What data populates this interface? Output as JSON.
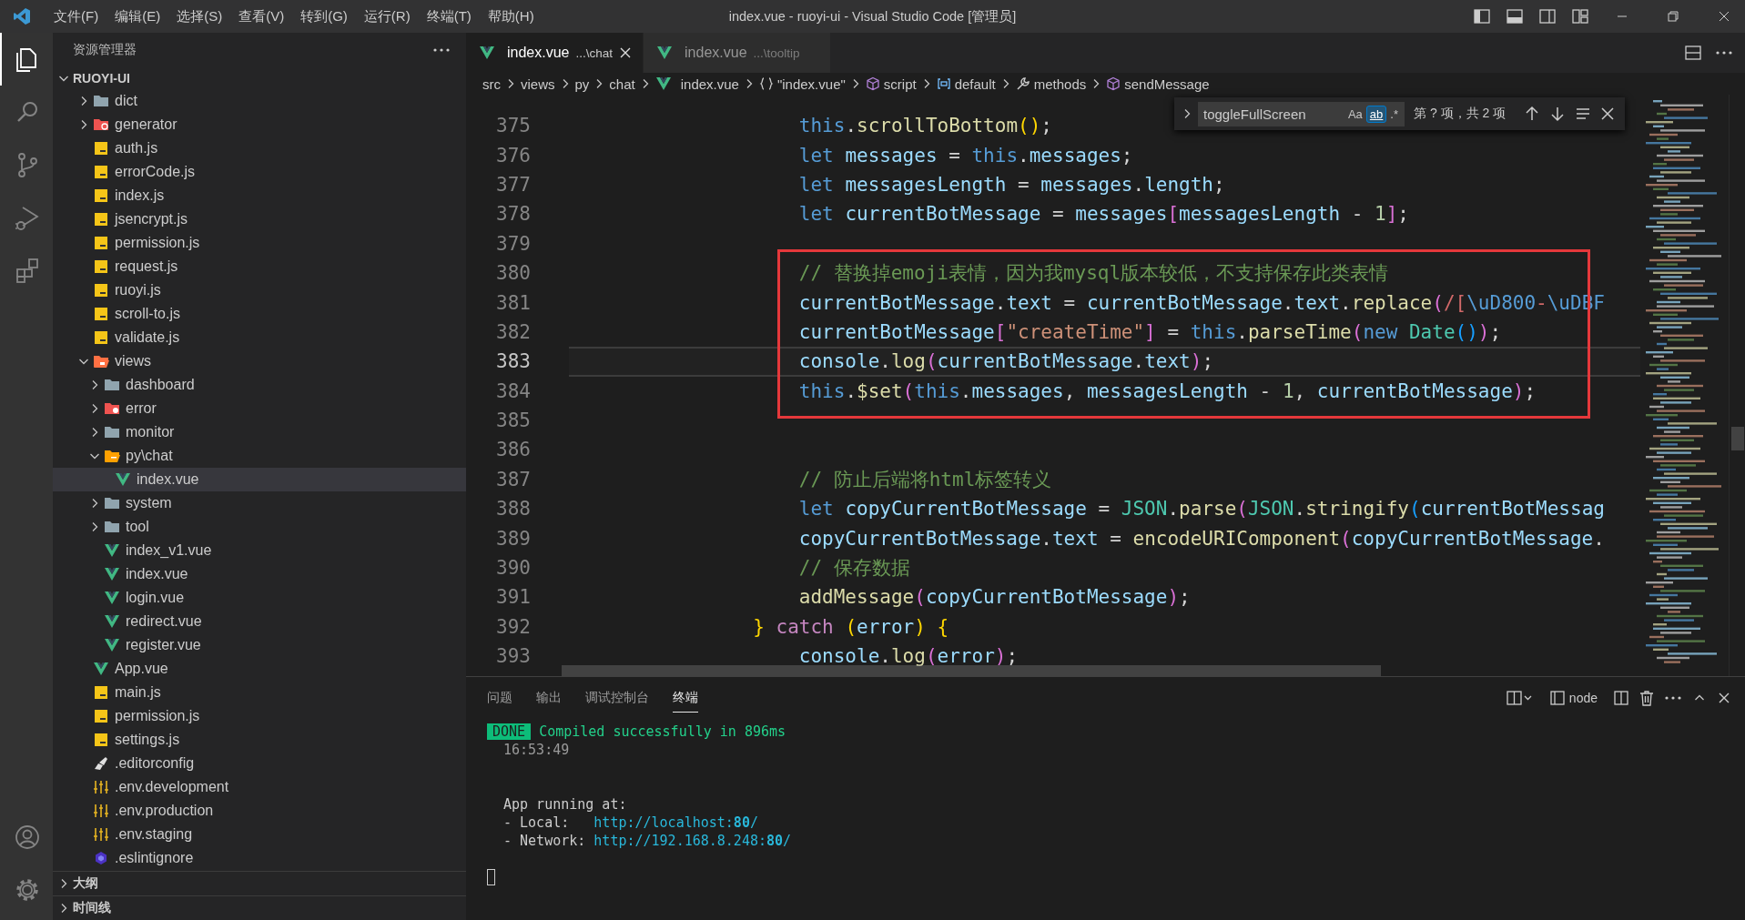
{
  "title_bar": {
    "menu": [
      "文件(F)",
      "编辑(E)",
      "选择(S)",
      "查看(V)",
      "转到(G)",
      "运行(R)",
      "终端(T)",
      "帮助(H)"
    ],
    "title": "index.vue - ruoyi-ui - Visual Studio Code [管理员]"
  },
  "activity_bar": [
    {
      "kind": "explorer",
      "selected": true
    },
    {
      "kind": "search",
      "selected": false
    },
    {
      "kind": "source-control",
      "selected": false
    },
    {
      "kind": "run-debug",
      "selected": false
    },
    {
      "kind": "extensions",
      "selected": false
    }
  ],
  "activity_bar_bottom": [
    {
      "kind": "account"
    },
    {
      "kind": "settings"
    }
  ],
  "sidebar": {
    "title": "资源管理器",
    "project": {
      "name": "RUOYI-UI",
      "expanded": true
    },
    "tree": [
      {
        "children": [
          {
            "children": [
              {
                "name": "dict",
                "kind": "folder",
                "expanded": false,
                "selected": false
              },
              {
                "name": "generator",
                "kind": "folder-generator",
                "expanded": false,
                "selected": false
              },
              {
                "name": "auth.js",
                "kind": "js",
                "selected": false
              },
              {
                "name": "errorCode.js",
                "kind": "js",
                "selected": false
              },
              {
                "name": "index.js",
                "kind": "js",
                "selected": false
              },
              {
                "name": "jsencrypt.js",
                "kind": "js",
                "selected": false
              },
              {
                "name": "permission.js",
                "kind": "js",
                "selected": false
              },
              {
                "name": "request.js",
                "kind": "js",
                "selected": false
              },
              {
                "name": "ruoyi.js",
                "kind": "js",
                "selected": false
              },
              {
                "name": "scroll-to.js",
                "kind": "js",
                "selected": false
              },
              {
                "name": "validate.js",
                "kind": "js",
                "selected": false
              }
            ]
          },
          {
            "name": "views",
            "kind": "folder-views",
            "expanded": true,
            "selected": false,
            "children": [
              {
                "name": "dashboard",
                "kind": "folder",
                "expanded": false,
                "selected": false
              },
              {
                "name": "error",
                "kind": "folder-error",
                "expanded": false,
                "selected": false
              },
              {
                "name": "monitor",
                "kind": "folder",
                "expanded": false,
                "selected": false
              },
              {
                "name": "py\\chat",
                "kind": "folder-chat",
                "expanded": true,
                "selected": false,
                "children": [
                  {
                    "name": "index.vue",
                    "kind": "vue",
                    "selected": true
                  }
                ]
              },
              {
                "name": "system",
                "kind": "folder",
                "expanded": false,
                "selected": false
              },
              {
                "name": "tool",
                "kind": "folder",
                "expanded": false,
                "selected": false
              },
              {
                "name": "index_v1.vue",
                "kind": "vue",
                "selected": false
              },
              {
                "name": "index.vue",
                "kind": "vue",
                "selected": false
              },
              {
                "name": "login.vue",
                "kind": "vue",
                "selected": false
              },
              {
                "name": "redirect.vue",
                "kind": "vue",
                "selected": false
              },
              {
                "name": "register.vue",
                "kind": "vue",
                "selected": false
              }
            ]
          },
          {
            "name": "App.vue",
            "kind": "vue",
            "selected": false
          },
          {
            "name": "main.js",
            "kind": "js",
            "selected": false
          },
          {
            "name": "permission.js",
            "kind": "js",
            "selected": false
          },
          {
            "name": "settings.js",
            "kind": "js",
            "selected": false
          }
        ]
      },
      {
        "name": ".editorconfig",
        "kind": "editorconfig",
        "selected": false
      },
      {
        "name": ".env.development",
        "kind": "env",
        "selected": false
      },
      {
        "name": ".env.production",
        "kind": "env",
        "selected": false
      },
      {
        "name": ".env.staging",
        "kind": "env",
        "selected": false
      },
      {
        "name": ".eslintignore",
        "kind": "eslint",
        "selected": false
      }
    ],
    "sections": [
      {
        "name": "大纲",
        "expanded": false
      },
      {
        "name": "时间线",
        "expanded": false
      }
    ]
  },
  "editor": {
    "tabs": [
      {
        "name": "index.vue",
        "description": "...\\chat",
        "selected": true
      },
      {
        "name": "index.vue",
        "description": "...\\tooltip",
        "selected": false
      }
    ],
    "breadcrumbs": [
      {
        "text": "src",
        "kind": "plain"
      },
      {
        "text": "views",
        "kind": "plain"
      },
      {
        "text": "py",
        "kind": "plain"
      },
      {
        "text": "chat",
        "kind": "plain"
      },
      {
        "text": "index.vue",
        "kind": "vue"
      },
      {
        "text": "\"index.vue\"",
        "kind": "module"
      },
      {
        "text": "script",
        "kind": "cube"
      },
      {
        "text": "default",
        "kind": "field"
      },
      {
        "text": "methods",
        "kind": "wrench"
      },
      {
        "text": "sendMessage",
        "kind": "method"
      }
    ],
    "find": {
      "query": "toggleFullScreen",
      "options": [
        {
          "label": "Aa",
          "on": false
        },
        {
          "label": "ab",
          "on": true
        },
        {
          "label": ".*",
          "on": false
        }
      ],
      "result": "第 ? 项，共 2 项"
    },
    "lines": [
      {
        "number": "375",
        "kind": "inner",
        "current": false,
        "tokens": [
          {
            "text": "this",
            "kind": "kw"
          },
          {
            "text": ".",
            "kind": "p"
          },
          {
            "text": "scrollToBottom",
            "kind": "fn"
          },
          {
            "text": "()",
            "kind": "b1"
          },
          {
            "text": ";",
            "kind": "p"
          }
        ]
      },
      {
        "number": "376",
        "kind": "inner",
        "current": false,
        "tokens": [
          {
            "text": "let",
            "kind": "kw"
          },
          {
            "text": " messages",
            "kind": "var"
          },
          {
            "text": " = ",
            "kind": "p"
          },
          {
            "text": "this",
            "kind": "kw"
          },
          {
            "text": ".",
            "kind": "p"
          },
          {
            "text": "messages",
            "kind": "var"
          },
          {
            "text": ";",
            "kind": "p"
          }
        ]
      },
      {
        "number": "377",
        "kind": "inner",
        "current": false,
        "tokens": [
          {
            "text": "let",
            "kind": "kw"
          },
          {
            "text": " messagesLength",
            "kind": "var"
          },
          {
            "text": " = ",
            "kind": "p"
          },
          {
            "text": "messages",
            "kind": "var"
          },
          {
            "text": ".",
            "kind": "p"
          },
          {
            "text": "length",
            "kind": "var"
          },
          {
            "text": ";",
            "kind": "p"
          }
        ]
      },
      {
        "number": "378",
        "kind": "inner",
        "current": false,
        "tokens": [
          {
            "text": "let",
            "kind": "kw"
          },
          {
            "text": " currentBotMessage",
            "kind": "var"
          },
          {
            "text": " = ",
            "kind": "p"
          },
          {
            "text": "messages",
            "kind": "var"
          },
          {
            "text": "[",
            "kind": "b2"
          },
          {
            "text": "messagesLength",
            "kind": "var"
          },
          {
            "text": " - ",
            "kind": "p"
          },
          {
            "text": "1",
            "kind": "num"
          },
          {
            "text": "]",
            "kind": "b2"
          },
          {
            "text": ";",
            "kind": "p"
          }
        ]
      },
      {
        "number": "379",
        "kind": "inner",
        "current": false
      },
      {
        "kind": "frame",
        "lines": [
          {
            "number": "380",
            "kind": "inner",
            "current": false,
            "tokens": [
              {
                "text": "// 替换掉emoji表情，因为我mysql版本较低，不支持保存此类表情",
                "kind": "cmt"
              }
            ]
          },
          {
            "number": "381",
            "kind": "inner",
            "current": false,
            "tokens": [
              {
                "text": "currentBotMessage",
                "kind": "var"
              },
              {
                "text": ".",
                "kind": "p"
              },
              {
                "text": "text",
                "kind": "var"
              },
              {
                "text": " = ",
                "kind": "p"
              },
              {
                "text": "currentBotMessage",
                "kind": "var"
              },
              {
                "text": ".",
                "kind": "p"
              },
              {
                "text": "text",
                "kind": "var"
              },
              {
                "text": ".",
                "kind": "p"
              },
              {
                "text": "replace",
                "kind": "fn"
              },
              {
                "text": "(",
                "kind": "b2"
              },
              {
                "text": "/[",
                "kind": "rx"
              },
              {
                "text": "\\uD800",
                "kind": "esc"
              },
              {
                "text": "-",
                "kind": "rx"
              },
              {
                "text": "\\uDBF",
                "kind": "esc"
              }
            ]
          },
          {
            "number": "382",
            "kind": "inner",
            "current": false,
            "tokens": [
              {
                "text": "currentBotMessage",
                "kind": "var"
              },
              {
                "text": "[",
                "kind": "b2"
              },
              {
                "text": "\"createTime\"",
                "kind": "str"
              },
              {
                "text": "]",
                "kind": "b2"
              },
              {
                "text": " = ",
                "kind": "p"
              },
              {
                "text": "this",
                "kind": "kw"
              },
              {
                "text": ".",
                "kind": "p"
              },
              {
                "text": "parseTime",
                "kind": "fn"
              },
              {
                "text": "(",
                "kind": "b2"
              },
              {
                "text": "new ",
                "kind": "kw"
              },
              {
                "text": "Date",
                "kind": "cls"
              },
              {
                "text": "()",
                "kind": "b3"
              },
              {
                "text": ")",
                "kind": "b2"
              },
              {
                "text": ";",
                "kind": "p"
              }
            ]
          },
          {
            "number": "383",
            "kind": "inner",
            "current": true,
            "tokens": [
              {
                "text": "console",
                "kind": "var"
              },
              {
                "text": ".",
                "kind": "p"
              },
              {
                "text": "log",
                "kind": "fn"
              },
              {
                "text": "(",
                "kind": "b2"
              },
              {
                "text": "currentBotMessage",
                "kind": "var"
              },
              {
                "text": ".",
                "kind": "p"
              },
              {
                "text": "text",
                "kind": "var"
              },
              {
                "text": ")",
                "kind": "b2"
              },
              {
                "text": ";",
                "kind": "p"
              }
            ]
          },
          {
            "number": "384",
            "kind": "inner",
            "current": false,
            "tokens": [
              {
                "text": "this",
                "kind": "kw"
              },
              {
                "text": ".",
                "kind": "p"
              },
              {
                "text": "$set",
                "kind": "fn"
              },
              {
                "text": "(",
                "kind": "b2"
              },
              {
                "text": "this",
                "kind": "kw"
              },
              {
                "text": ".",
                "kind": "p"
              },
              {
                "text": "messages",
                "kind": "var"
              },
              {
                "text": ", ",
                "kind": "p"
              },
              {
                "text": "messagesLength",
                "kind": "var"
              },
              {
                "text": " - ",
                "kind": "p"
              },
              {
                "text": "1",
                "kind": "num"
              },
              {
                "text": ", ",
                "kind": "p"
              },
              {
                "text": "currentBotMessage",
                "kind": "var"
              },
              {
                "text": ")",
                "kind": "b2"
              },
              {
                "text": ";",
                "kind": "p"
              }
            ]
          }
        ]
      },
      {
        "number": "385",
        "kind": "inner",
        "current": false
      },
      {
        "number": "386",
        "kind": "inner",
        "current": false
      },
      {
        "number": "387",
        "kind": "inner",
        "current": false,
        "tokens": [
          {
            "text": "// 防止后端将html标签转义",
            "kind": "cmt"
          }
        ]
      },
      {
        "number": "388",
        "kind": "inner",
        "current": false,
        "tokens": [
          {
            "text": "let",
            "kind": "kw"
          },
          {
            "text": " copyCurrentBotMessage",
            "kind": "var"
          },
          {
            "text": " = ",
            "kind": "p"
          },
          {
            "text": "JSON",
            "kind": "cls"
          },
          {
            "text": ".",
            "kind": "p"
          },
          {
            "text": "parse",
            "kind": "fn"
          },
          {
            "text": "(",
            "kind": "b2"
          },
          {
            "text": "JSON",
            "kind": "cls"
          },
          {
            "text": ".",
            "kind": "p"
          },
          {
            "text": "stringify",
            "kind": "fn"
          },
          {
            "text": "(",
            "kind": "b3"
          },
          {
            "text": "currentBotMessag",
            "kind": "var"
          }
        ]
      },
      {
        "number": "389",
        "kind": "inner",
        "current": false,
        "tokens": [
          {
            "text": "copyCurrentBotMessage",
            "kind": "var"
          },
          {
            "text": ".",
            "kind": "p"
          },
          {
            "text": "text",
            "kind": "var"
          },
          {
            "text": " = ",
            "kind": "p"
          },
          {
            "text": "encodeURIComponent",
            "kind": "fn"
          },
          {
            "text": "(",
            "kind": "b2"
          },
          {
            "text": "copyCurrentBotMessage",
            "kind": "var"
          },
          {
            "text": ".",
            "kind": "p"
          }
        ]
      },
      {
        "number": "390",
        "kind": "inner",
        "current": false,
        "tokens": [
          {
            "text": "// 保存数据",
            "kind": "cmt"
          }
        ]
      },
      {
        "number": "391",
        "kind": "inner",
        "current": false,
        "tokens": [
          {
            "text": "addMessage",
            "kind": "fn"
          },
          {
            "text": "(",
            "kind": "b2"
          },
          {
            "text": "copyCurrentBotMessage",
            "kind": "var"
          },
          {
            "text": ")",
            "kind": "b2"
          },
          {
            "text": ";",
            "kind": "p"
          }
        ]
      },
      {
        "number": "392",
        "kind": "outer",
        "current": false,
        "tokens": [
          {
            "text": "} ",
            "kind": "b1"
          },
          {
            "text": "catch ",
            "kind": "ctl"
          },
          {
            "text": "(",
            "kind": "b1"
          },
          {
            "text": "error",
            "kind": "var"
          },
          {
            "text": ") {",
            "kind": "b1"
          }
        ]
      },
      {
        "number": "393",
        "kind": "inner",
        "current": false,
        "tokens": [
          {
            "text": "console",
            "kind": "var"
          },
          {
            "text": ".",
            "kind": "p"
          },
          {
            "text": "log",
            "kind": "fn"
          },
          {
            "text": "(",
            "kind": "b2"
          },
          {
            "text": "error",
            "kind": "var"
          },
          {
            "text": ")",
            "kind": "b2"
          },
          {
            "text": ";",
            "kind": "p"
          }
        ]
      }
    ]
  },
  "panel": {
    "tabs": [
      {
        "label": "问题",
        "selected": false
      },
      {
        "label": "输出",
        "selected": false
      },
      {
        "label": "调试控制台",
        "selected": false
      },
      {
        "label": "终端",
        "selected": true
      }
    ],
    "terminal_name": "node",
    "lines": [
      {
        "kind": "status",
        "badge": "DONE",
        "text": "Compiled successfully in 896ms"
      },
      {
        "kind": "muted",
        "text": "16:53:49"
      },
      {
        "kind": "blank"
      },
      {
        "kind": "blank"
      },
      {
        "kind": "plain",
        "text": "App running at:"
      },
      {
        "kind": "link",
        "text": "- Local:",
        "link": "http://localhost:**80**/"
      },
      {
        "kind": "link",
        "text": "- Network:",
        "link": "http://192.168.8.248:**80**/"
      },
      {
        "kind": "blank"
      },
      {
        "kind": "cursor"
      }
    ]
  }
}
